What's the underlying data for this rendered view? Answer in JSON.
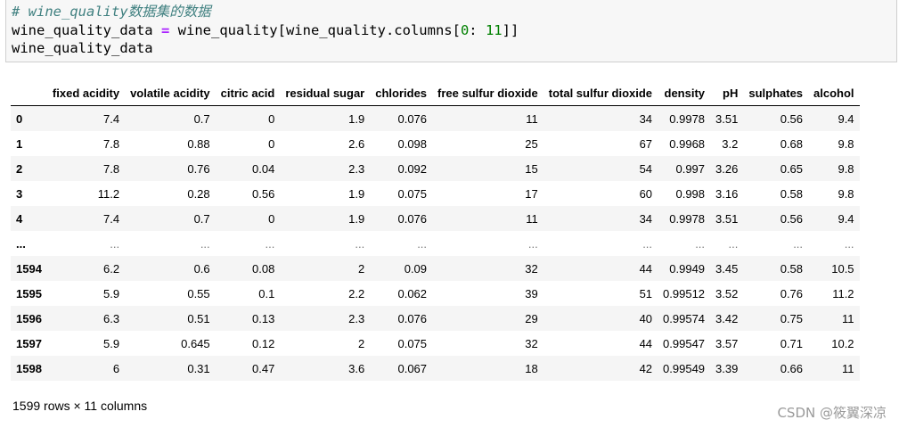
{
  "code": {
    "comment": "# wine_quality数据集的数据",
    "line2_a": "wine_quality_data ",
    "line2_op": "=",
    "line2_b": " wine_quality[wine_quality.columns[",
    "line2_num1": "0",
    "line2_c": ": ",
    "line2_num2": "11",
    "line2_d": "]]",
    "line3": "wine_quality_data"
  },
  "table": {
    "columns": [
      "",
      "fixed acidity",
      "volatile acidity",
      "citric acid",
      "residual sugar",
      "chlorides",
      "free sulfur dioxide",
      "total sulfur dioxide",
      "density",
      "pH",
      "sulphates",
      "alcohol"
    ],
    "rows": [
      [
        "0",
        "7.4",
        "0.7",
        "0",
        "1.9",
        "0.076",
        "11",
        "34",
        "0.9978",
        "3.51",
        "0.56",
        "9.4"
      ],
      [
        "1",
        "7.8",
        "0.88",
        "0",
        "2.6",
        "0.098",
        "25",
        "67",
        "0.9968",
        "3.2",
        "0.68",
        "9.8"
      ],
      [
        "2",
        "7.8",
        "0.76",
        "0.04",
        "2.3",
        "0.092",
        "15",
        "54",
        "0.997",
        "3.26",
        "0.65",
        "9.8"
      ],
      [
        "3",
        "11.2",
        "0.28",
        "0.56",
        "1.9",
        "0.075",
        "17",
        "60",
        "0.998",
        "3.16",
        "0.58",
        "9.8"
      ],
      [
        "4",
        "7.4",
        "0.7",
        "0",
        "1.9",
        "0.076",
        "11",
        "34",
        "0.9978",
        "3.51",
        "0.56",
        "9.4"
      ],
      [
        "...",
        "...",
        "...",
        "...",
        "...",
        "...",
        "...",
        "...",
        "...",
        "...",
        "...",
        "..."
      ],
      [
        "1594",
        "6.2",
        "0.6",
        "0.08",
        "2",
        "0.09",
        "32",
        "44",
        "0.9949",
        "3.45",
        "0.58",
        "10.5"
      ],
      [
        "1595",
        "5.9",
        "0.55",
        "0.1",
        "2.2",
        "0.062",
        "39",
        "51",
        "0.99512",
        "3.52",
        "0.76",
        "11.2"
      ],
      [
        "1596",
        "6.3",
        "0.51",
        "0.13",
        "2.3",
        "0.076",
        "29",
        "40",
        "0.99574",
        "3.42",
        "0.75",
        "11"
      ],
      [
        "1597",
        "5.9",
        "0.645",
        "0.12",
        "2",
        "0.075",
        "32",
        "44",
        "0.99547",
        "3.57",
        "0.71",
        "10.2"
      ],
      [
        "1598",
        "6",
        "0.31",
        "0.47",
        "3.6",
        "0.067",
        "18",
        "42",
        "0.99549",
        "3.39",
        "0.66",
        "11"
      ]
    ]
  },
  "footer": "1599 rows × 11 columns",
  "watermark": "CSDN @筱翼深凉"
}
